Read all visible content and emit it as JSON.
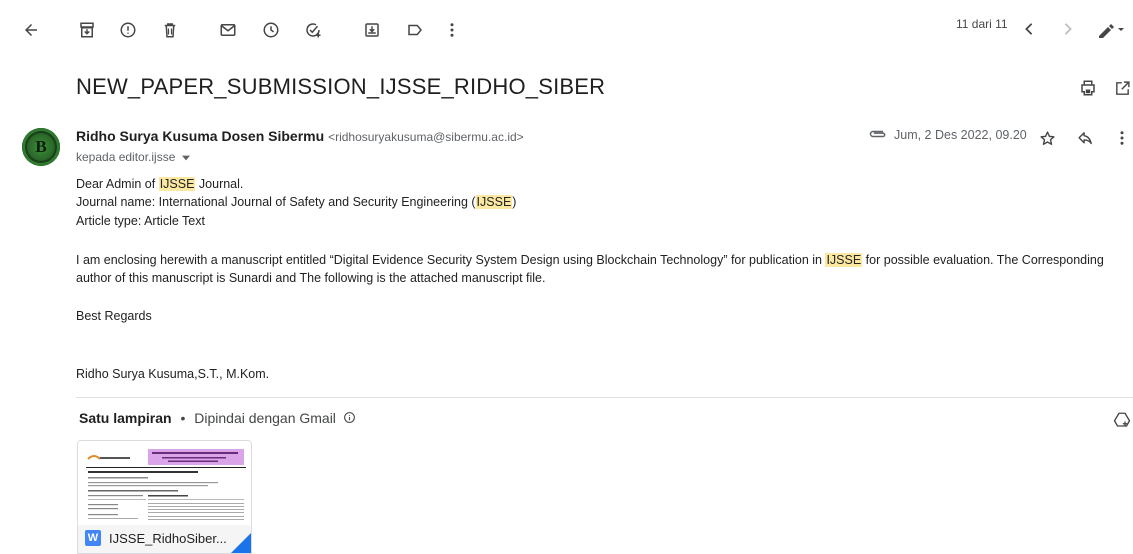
{
  "toolbar": {
    "icons": [
      "back-arrow-icon",
      "archive-icon",
      "report-spam-icon",
      "delete-icon",
      "mark-unread-icon",
      "snooze-icon",
      "add-task-icon",
      "move-to-icon",
      "label-icon",
      "more-vert-icon"
    ],
    "counter": "11 dari 11"
  },
  "email": {
    "subject": "NEW_PAPER_SUBMISSION_IJSSE_RIDHO_SIBER",
    "avatar_letter": "B",
    "sender_name": "Ridho Surya Kusuma Dosen Sibermu",
    "sender_email": "<ridhosuryakusuma@sibermu.ac.id>",
    "to": "kepada editor.ijsse",
    "date": "Jum, 2 Des 2022, 09.20",
    "body": {
      "line1_a": "Dear Admin of ",
      "line1_hl": "IJSSE",
      "line1_b": " Journal.",
      "line2_a": "Journal name: International Journal of Safety and Security Engineering (",
      "line2_hl": "IJSSE",
      "line2_b": ")",
      "line3": "Article type: Article Text",
      "para_a": "I am enclosing herewith a manuscript entitled “Digital Evidence Security System Design using Blockchain Technology” for publication in ",
      "para_hl": "IJSSE",
      "para_b": " for possible evaluation. The Corresponding",
      "para2": "author of this manuscript is Sunardi and The following is the attached manuscript file.",
      "regards": "Best Regards",
      "signature": "Ridho Surya Kusuma,S.T., M.Kom."
    }
  },
  "attachments": {
    "title": "Satu lampiran",
    "dot": "•",
    "scanned": "Dipindai dengan Gmail",
    "file_name": "IJSSE_RidhoSiber...",
    "file_badge": "W"
  }
}
